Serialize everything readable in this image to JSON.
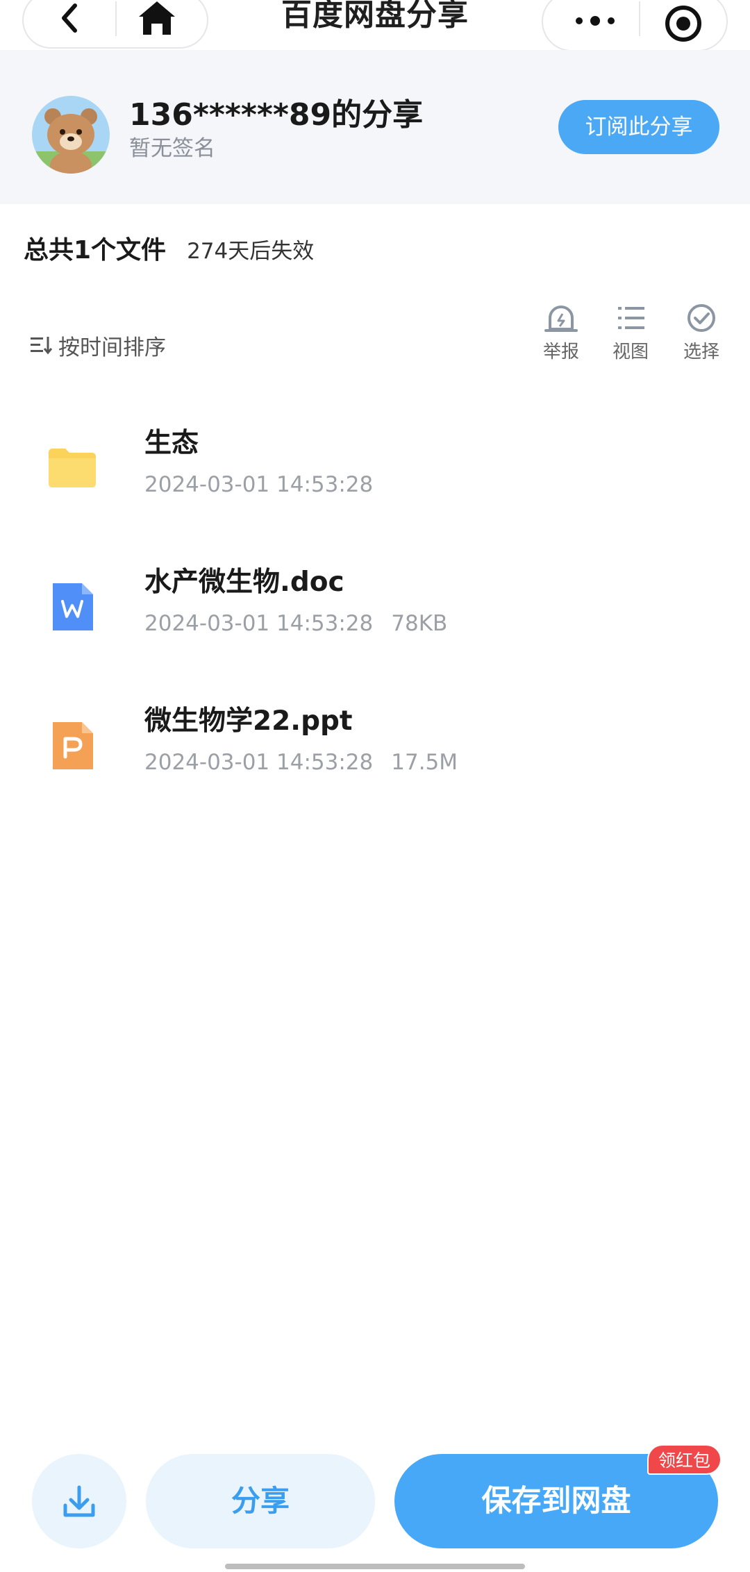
{
  "nav": {
    "title": "百度网盘分享"
  },
  "profile": {
    "name": "136******89的分享",
    "signature": "暂无签名",
    "subscribe_label": "订阅此分享"
  },
  "summary": {
    "total": "总共1个文件",
    "expire": "274天后失效"
  },
  "toolbar": {
    "sort_label": "按时间排序",
    "report_label": "举报",
    "view_label": "视图",
    "select_label": "选择"
  },
  "files": [
    {
      "name": "生态",
      "date": "2024-03-01 14:53:28",
      "size": "",
      "icon": "folder-icon"
    },
    {
      "name": "水产微生物.doc",
      "date": "2024-03-01 14:53:28",
      "size": "78KB",
      "icon": "word-doc-icon"
    },
    {
      "name": "微生物学22.ppt",
      "date": "2024-03-01 14:53:28",
      "size": "17.5M",
      "icon": "powerpoint-icon"
    }
  ],
  "bottom": {
    "share_label": "分享",
    "save_label": "保存到网盘",
    "badge_label": "领红包"
  },
  "colors": {
    "accent": "#46a8f6",
    "folder": "#fbd35a",
    "word": "#4f8ff7",
    "ppt": "#f4a055",
    "badge": "#f0484a"
  }
}
